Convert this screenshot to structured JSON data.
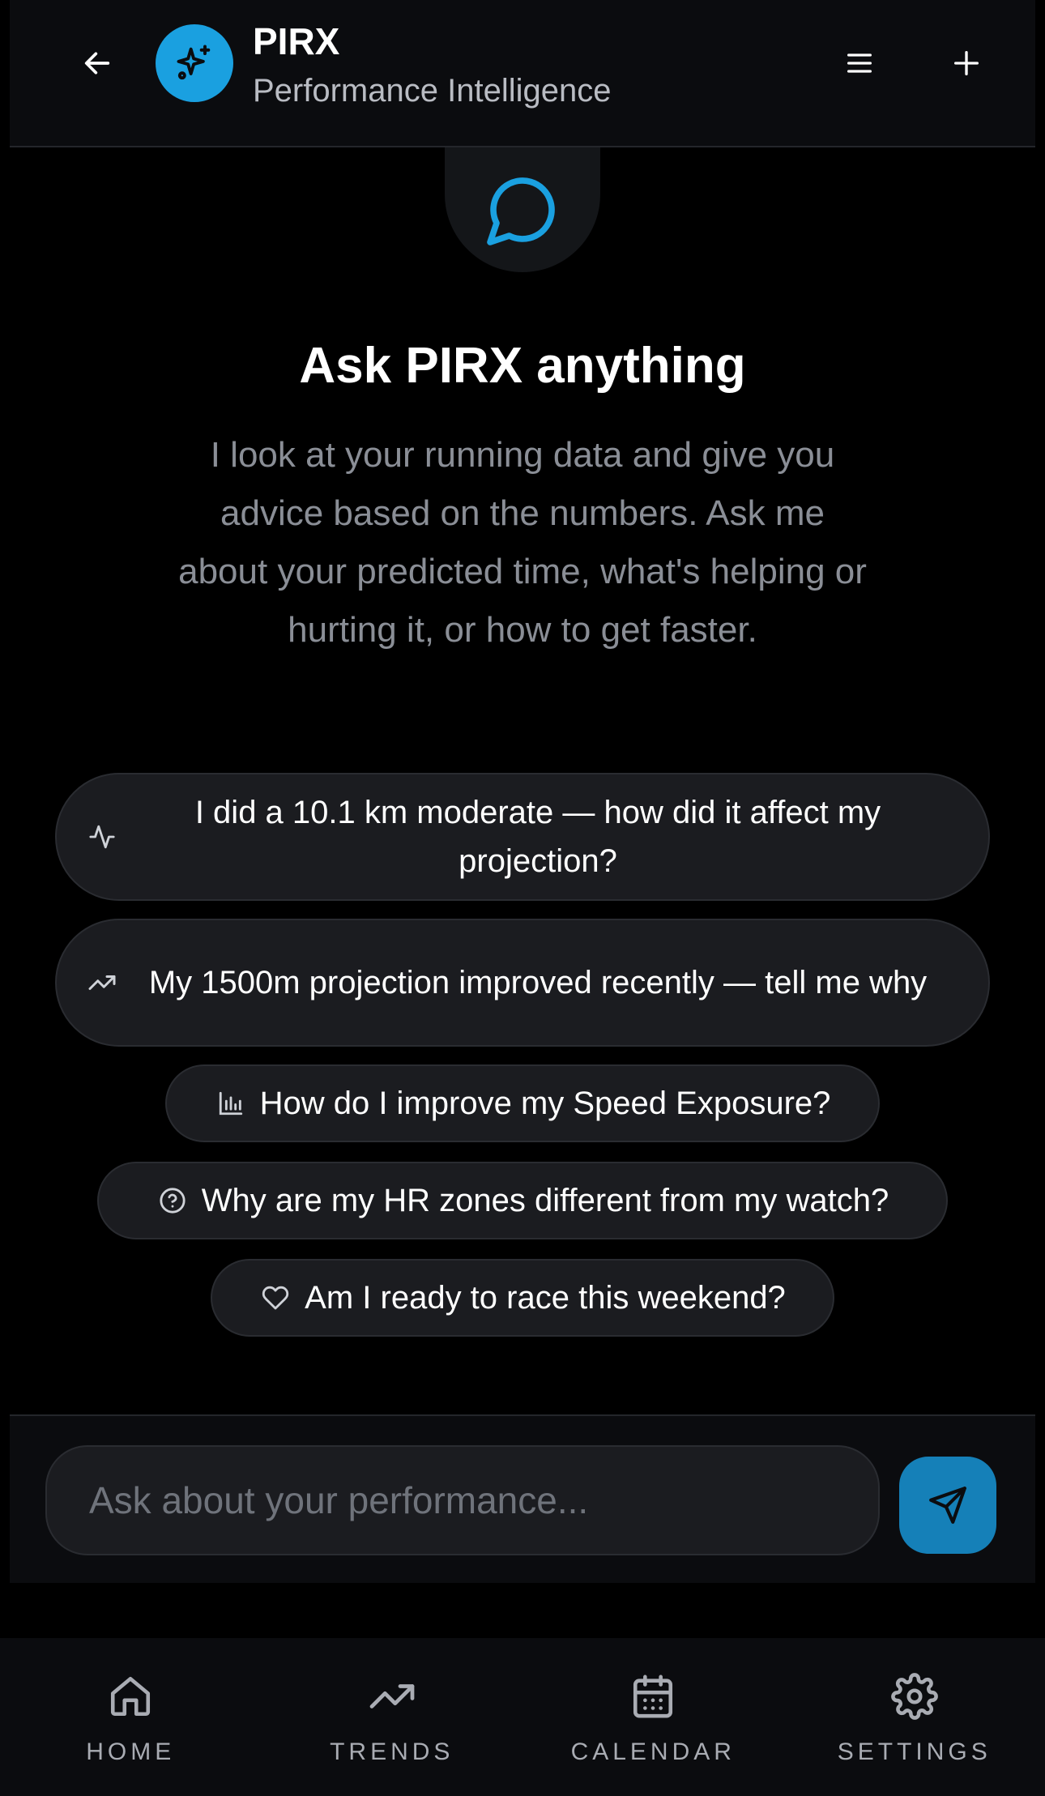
{
  "header": {
    "title": "PIRX",
    "subtitle": "Performance Intelligence",
    "icons": {
      "back": "arrow-left-icon",
      "logo": "sparkles-icon",
      "menu": "menu-icon",
      "new_chat": "plus-icon"
    }
  },
  "hero": {
    "icon": "chat-bubble-icon",
    "title": "Ask PIRX anything",
    "description": "I look at your running data and give you advice based on the numbers. Ask me about your predicted time, what's helping or hurting it, or how to get faster."
  },
  "suggestions": [
    {
      "icon": "activity-icon",
      "text": "I did a 10.1 km moderate — how did it affect my projection?"
    },
    {
      "icon": "trending-up-icon",
      "text": "My 1500m projection improved recently — tell me why"
    },
    {
      "icon": "bar-chart-icon",
      "text": "How do I improve my Speed Exposure?"
    },
    {
      "icon": "help-circle-icon",
      "text": "Why are my HR zones different from my watch?"
    },
    {
      "icon": "heart-icon",
      "text": "Am I ready to race this weekend?"
    }
  ],
  "composer": {
    "placeholder": "Ask about your performance...",
    "value": "",
    "send_icon": "send-icon"
  },
  "nav": [
    {
      "icon": "home-icon",
      "label": "HOME"
    },
    {
      "icon": "trending-up-icon",
      "label": "TRENDS"
    },
    {
      "icon": "calendar-icon",
      "label": "CALENDAR"
    },
    {
      "icon": "gear-icon",
      "label": "SETTINGS"
    }
  ],
  "colors": {
    "accent": "#1aa0e0",
    "send_button": "#1580b8",
    "background": "#000000",
    "surface": "#1b1c20",
    "muted_text": "#8a8e96"
  }
}
